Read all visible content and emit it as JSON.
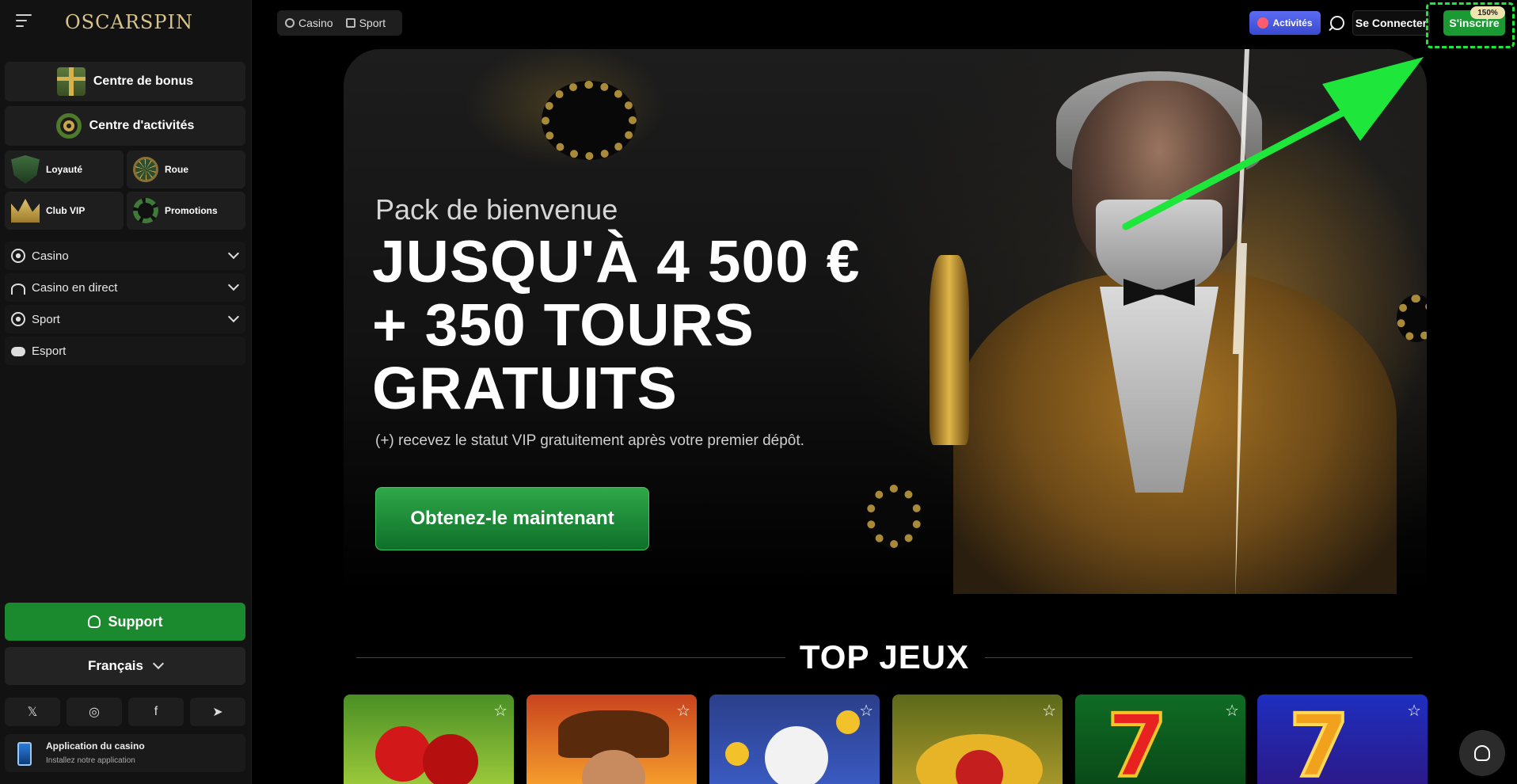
{
  "brand": {
    "logo_text": "OSCARSPIN",
    "accent": "#1b9a33",
    "annotation_color": "#1fe63a"
  },
  "sidebar": {
    "bonus_center": "Centre de bonus",
    "activity_center": "Centre d'activités",
    "tiles": [
      {
        "label": "Loyauté",
        "icon": "shield-icon"
      },
      {
        "label": "Roue",
        "icon": "wheel-icon"
      },
      {
        "label": "Club VIP",
        "icon": "crown-icon"
      },
      {
        "label": "Promotions",
        "icon": "chip-icon"
      }
    ],
    "nav": [
      {
        "label": "Casino",
        "icon": "casino-chip-icon",
        "expandable": true
      },
      {
        "label": "Casino en direct",
        "icon": "live-broadcast-icon",
        "expandable": true
      },
      {
        "label": "Sport",
        "icon": "soccer-ball-icon",
        "expandable": true
      },
      {
        "label": "Esport",
        "icon": "gamepad-icon",
        "expandable": false
      }
    ],
    "support_label": "Support",
    "language_label": "Français",
    "socials": [
      "𝕏",
      "◎",
      "f",
      "➤"
    ],
    "app_title": "Application du casino",
    "app_subtitle": "Installez notre application"
  },
  "header": {
    "tabs": [
      "Casino",
      "Sport"
    ],
    "activities_label": "Activités",
    "login_label": "Se Connecter",
    "signup_label": "S'inscrire",
    "signup_badge": "150%"
  },
  "hero": {
    "kicker": "Pack de bienvenue",
    "title_line1": "JUSQU'À 4 500 €",
    "title_line2": "+ 350 TOURS",
    "title_line3": "GRATUITS",
    "subtitle": "(+) recevez le statut VIP gratuitement après votre premier dépôt.",
    "cta_label": "Obtenez-le maintenant"
  },
  "top_games": {
    "title": "TOP JEUX",
    "games": [
      {
        "name": "cherry-slot"
      },
      {
        "name": "adventurer-slot"
      },
      {
        "name": "chicken-coins-slot"
      },
      {
        "name": "golden-fruit-slot"
      },
      {
        "name": "hot-seven-slot"
      },
      {
        "name": "purple-seven-slot"
      }
    ]
  }
}
